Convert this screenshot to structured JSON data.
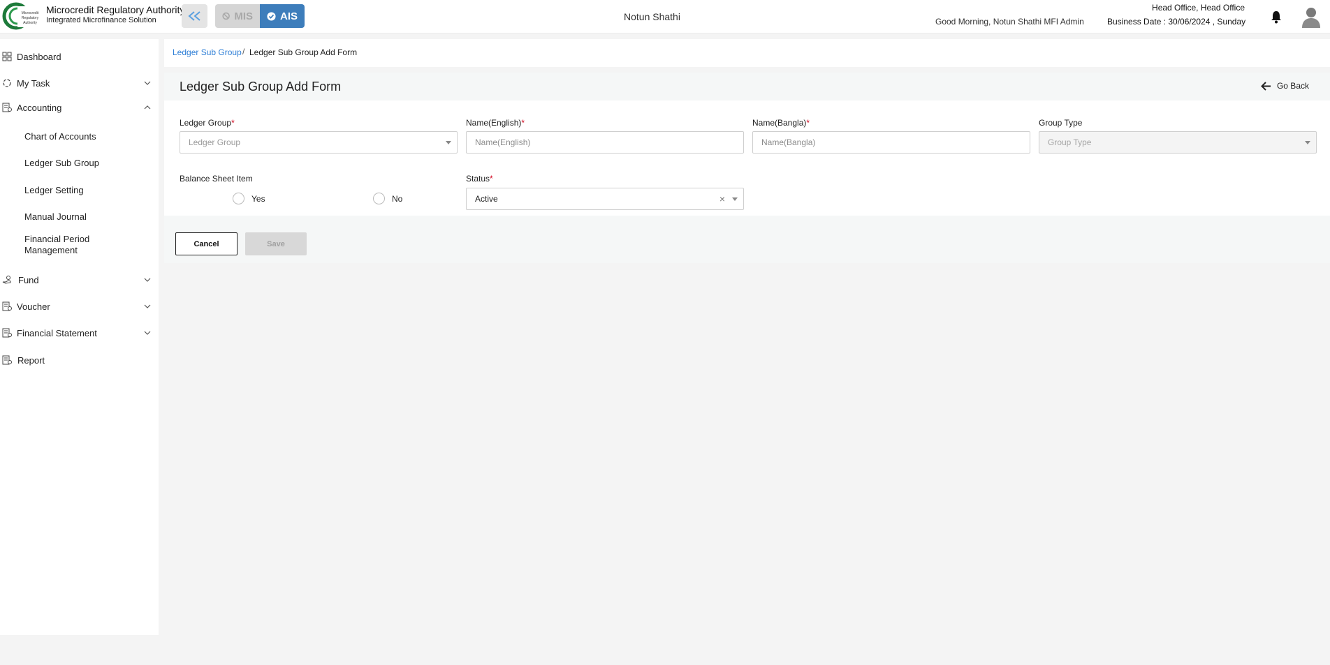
{
  "header": {
    "logo_text": "Microcredit Regulatory Authority",
    "brand_title": "Microcredit Regulatory Authority",
    "brand_subtitle": "Integrated Microfinance Solution",
    "modules": {
      "mis": "MIS",
      "ais": "AIS"
    },
    "org_name": "Notun Shathi",
    "greeting": "Good Morning, Notun Shathi MFI Admin",
    "office": "Head Office, Head Office",
    "business_date": "Business Date : 30/06/2024 , Sunday"
  },
  "sidebar": {
    "dashboard": "Dashboard",
    "my_task": "My Task",
    "accounting": "Accounting",
    "accounting_items": [
      "Chart of Accounts",
      "Ledger Sub Group",
      "Ledger Setting",
      "Manual Journal",
      "Financial Period Management"
    ],
    "fund": "Fund",
    "voucher": "Voucher",
    "financial_statement": "Financial Statement",
    "report": "Report"
  },
  "breadcrumb": {
    "link": "Ledger Sub Group",
    "separator": "/",
    "current": "Ledger Sub Group Add Form"
  },
  "form": {
    "title": "Ledger Sub Group Add Form",
    "go_back": "Go Back",
    "ledger_group": {
      "label": "Ledger Group",
      "placeholder": "Ledger Group"
    },
    "name_english": {
      "label": "Name(English)",
      "placeholder": "Name(English)"
    },
    "name_bangla": {
      "label": "Name(Bangla)",
      "placeholder": "Name(Bangla)"
    },
    "group_type": {
      "label": "Group Type",
      "placeholder": "Group Type"
    },
    "balance_sheet": {
      "label": "Balance Sheet Item",
      "yes": "Yes",
      "no": "No"
    },
    "status": {
      "label": "Status",
      "value": "Active",
      "clear": "×"
    },
    "required_mark": "*",
    "cancel": "Cancel",
    "save": "Save"
  },
  "colors": {
    "accent": "#3d7dbb",
    "link": "#2f7fd6",
    "required": "#d0021b"
  }
}
